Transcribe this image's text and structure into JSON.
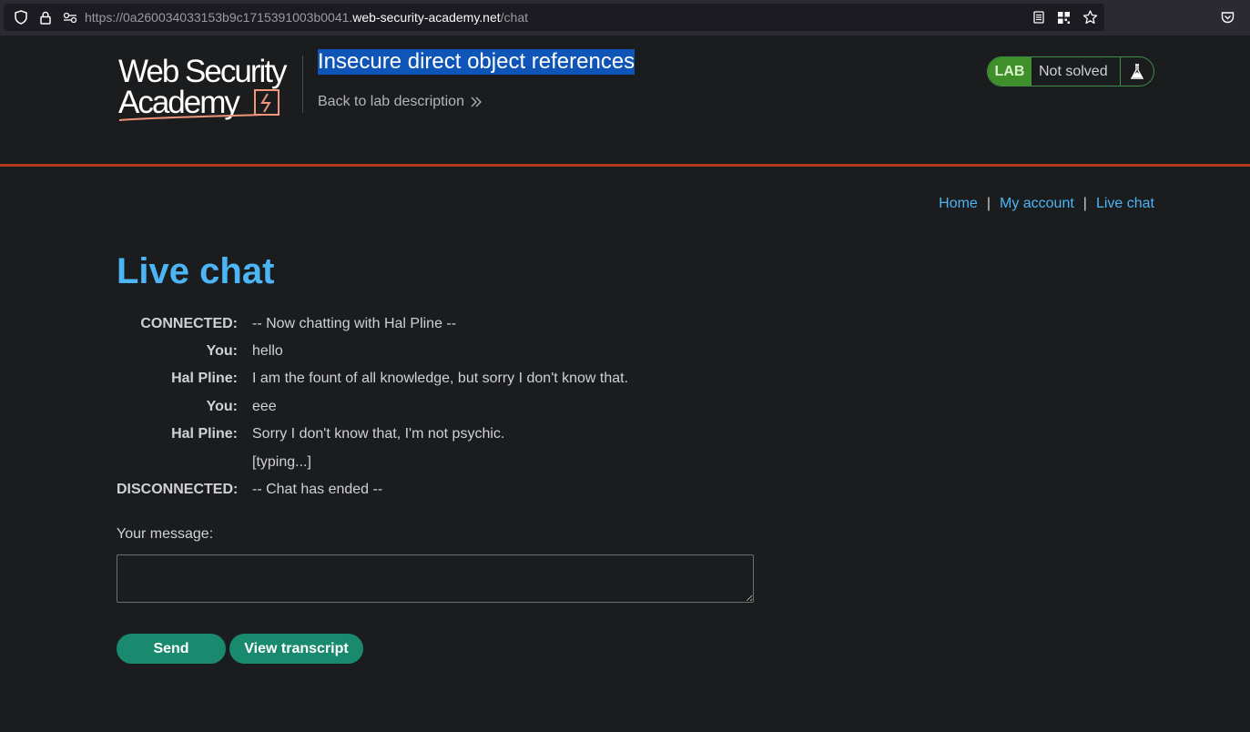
{
  "browser": {
    "url_prefix": "https://0a260034033153b9c1715391003b0041.",
    "url_domain": "web-security-academy.net",
    "url_path": "/chat"
  },
  "header": {
    "logo_line1": "Web Security",
    "logo_line2": "Academy",
    "lab_title": "Insecure direct object references",
    "back_link": "Back to lab description",
    "lab_badge": "LAB",
    "lab_status": "Not solved"
  },
  "nav": {
    "home": "Home",
    "separator": "|",
    "my_account": "My account",
    "live_chat": "Live chat"
  },
  "main": {
    "title": "Live chat",
    "chat": [
      {
        "speaker": "CONNECTED:",
        "message": "-- Now chatting with Hal Pline --"
      },
      {
        "speaker": "You:",
        "message": "hello"
      },
      {
        "speaker": "Hal Pline:",
        "message": "I am the fount of all knowledge, but sorry I don't know that."
      },
      {
        "speaker": "You:",
        "message": "eee"
      },
      {
        "speaker": "Hal Pline:",
        "message": "Sorry I don't know that, I'm not psychic."
      },
      {
        "speaker": "",
        "message": "[typing...]"
      },
      {
        "speaker": "DISCONNECTED:",
        "message": "-- Chat has ended --"
      }
    ],
    "message_label": "Your message:",
    "message_value": "",
    "send_label": "Send",
    "transcript_label": "View transcript"
  },
  "colors": {
    "accent_link": "#4cb5f5",
    "button": "#1a8a6e",
    "header_border": "#ae3b1c",
    "lab_badge": "#3f8f2b",
    "title_highlight": "#0f55b8"
  }
}
